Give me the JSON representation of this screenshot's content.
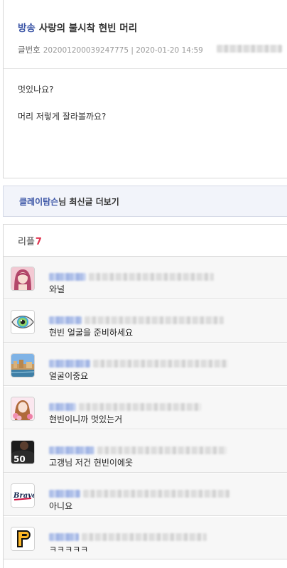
{
  "post": {
    "category": "방송",
    "title": "사랑의 불시착 현빈 머리",
    "meta_label": "글번호",
    "meta_value": "202001200039247775 | 2020-01-20 14:59",
    "body": [
      "멋있나요?",
      "머리 저렇게 잘라볼까요?"
    ]
  },
  "more": {
    "author": "클레이탐슨",
    "suffix": "님 최신글 더보기"
  },
  "replies": {
    "label": "리플",
    "count": "7",
    "items": [
      {
        "avatar": "woman-portrait",
        "text": "와널"
      },
      {
        "avatar": "eye-icon",
        "text": "현빈 얼굴을 준비하세요"
      },
      {
        "avatar": "city-landscape",
        "text": "얼굴이중요"
      },
      {
        "avatar": "woman-with-flowers",
        "text": "현빈이니까 멋있는거"
      },
      {
        "avatar": "baseball-jersey-50",
        "text": "고갱님 저건 현빈이에옷"
      },
      {
        "avatar": "braves-logo",
        "text": "아니요"
      },
      {
        "avatar": "pirates-p-logo",
        "text": "ㅋㅋㅋㅋㅋ"
      }
    ]
  },
  "colors": {
    "category_blue": "#3b55a6",
    "reply_count_red": "#e0334f",
    "more_bar_bg": "#f2f4fa"
  }
}
